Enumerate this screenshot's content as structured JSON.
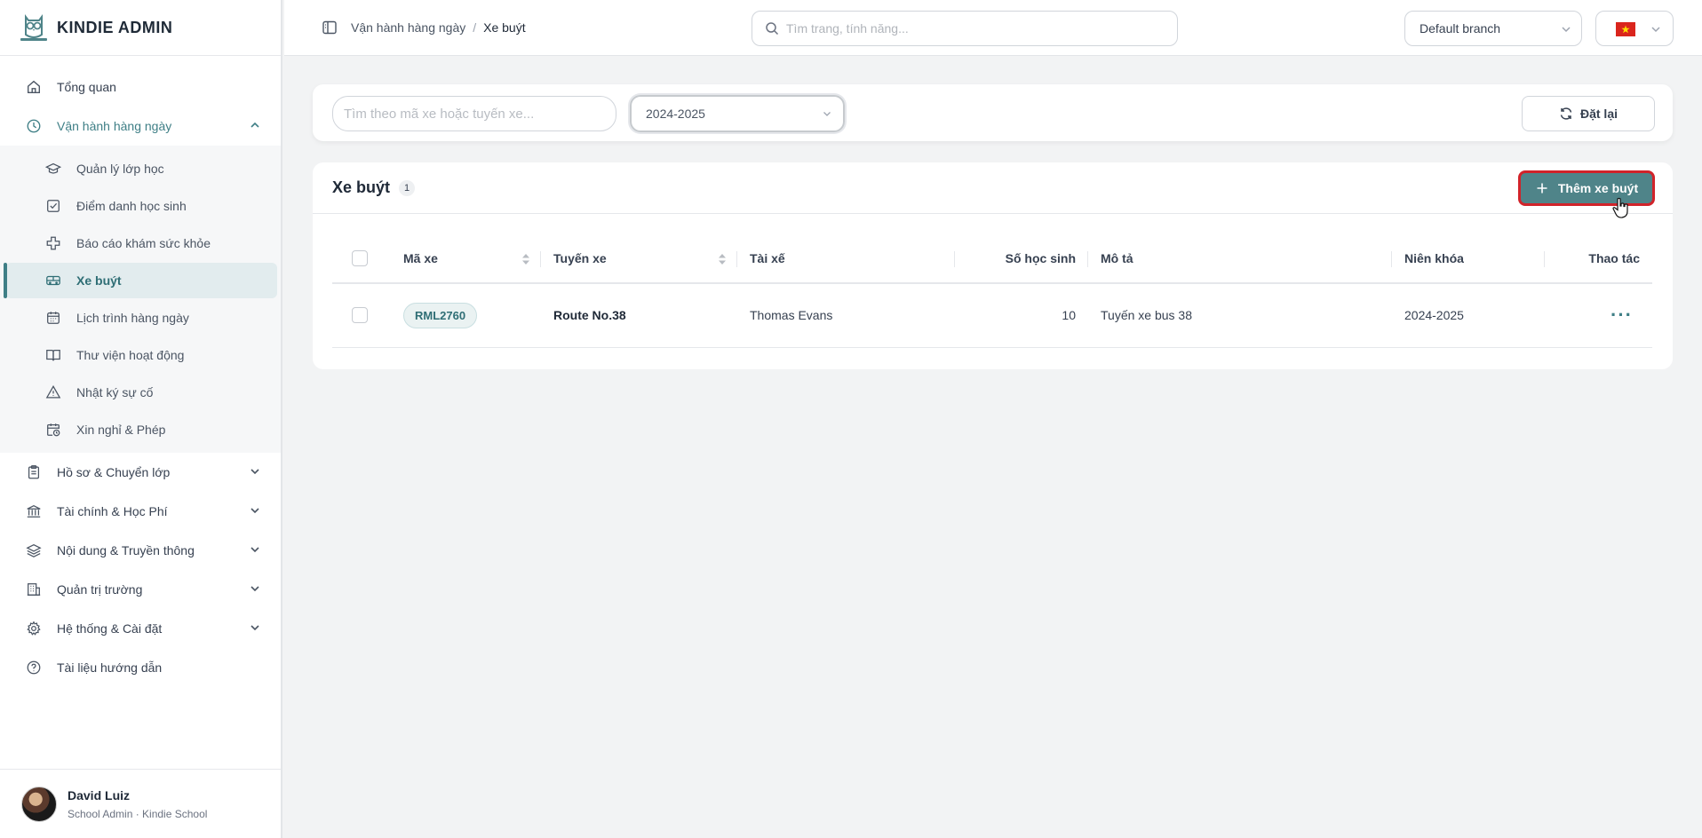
{
  "app": {
    "brand": "KINDIE ADMIN"
  },
  "sidebar": {
    "items": [
      {
        "label": "Tổng quan",
        "icon": "home-icon"
      },
      {
        "label": "Vận hành hàng ngày",
        "icon": "clock-icon"
      },
      {
        "label": "Hồ sơ & Chuyển lớp",
        "icon": "clipboard-icon"
      },
      {
        "label": "Tài chính & Học Phí",
        "icon": "bank-icon"
      },
      {
        "label": "Nội dung & Truyền thông",
        "icon": "layers-icon"
      },
      {
        "label": "Quản trị trường",
        "icon": "building-icon"
      },
      {
        "label": "Hệ thống & Cài đặt",
        "icon": "gear-icon"
      },
      {
        "label": "Tài liệu hướng dẫn",
        "icon": "help-icon"
      }
    ],
    "sub_items": [
      {
        "label": "Quản lý lớp học",
        "icon": "graduation-cap-icon"
      },
      {
        "label": "Điểm danh học sinh",
        "icon": "checkbox-icon"
      },
      {
        "label": "Báo cáo khám sức khỏe",
        "icon": "medical-cross-icon"
      },
      {
        "label": "Xe buýt",
        "icon": "bus-icon"
      },
      {
        "label": "Lịch trình hàng ngày",
        "icon": "calendar-icon"
      },
      {
        "label": "Thư viện hoạt động",
        "icon": "book-icon"
      },
      {
        "label": "Nhật ký sự cố",
        "icon": "warning-icon"
      },
      {
        "label": "Xin nghỉ & Phép",
        "icon": "calendar-clock-icon"
      }
    ],
    "active": "Xe buýt",
    "user": {
      "name": "David Luiz",
      "role": "School Admin · Kindie School"
    }
  },
  "topbar": {
    "breadcrumb": [
      "Vận hành hàng ngày",
      "Xe buýt"
    ],
    "breadcrumb_sep": "/",
    "search_placeholder": "Tìm trang, tính năng...",
    "branch": "Default branch",
    "language": "vietnam-flag-icon"
  },
  "filters": {
    "search_placeholder": "Tìm theo mã xe hoặc tuyến xe...",
    "year_value": "2024-2025",
    "reset_label": "Đặt lại"
  },
  "bus_table": {
    "title": "Xe buýt",
    "count": "1",
    "add_label": "Thêm xe buýt",
    "columns": [
      "Mã xe",
      "Tuyến xe",
      "Tài xế",
      "Số học sinh",
      "Mô tả",
      "Niên khóa",
      "Thao tác"
    ],
    "rows": [
      {
        "code": "RML2760",
        "route": "Route No.38",
        "driver": "Thomas Evans",
        "students": "10",
        "description": "Tuyến xe bus 38",
        "year": "2024-2025",
        "actions": "···"
      }
    ]
  },
  "colors": {
    "accent": "#3f7f86",
    "primary_button": "#4f8489",
    "highlight_border": "#d1232a"
  }
}
